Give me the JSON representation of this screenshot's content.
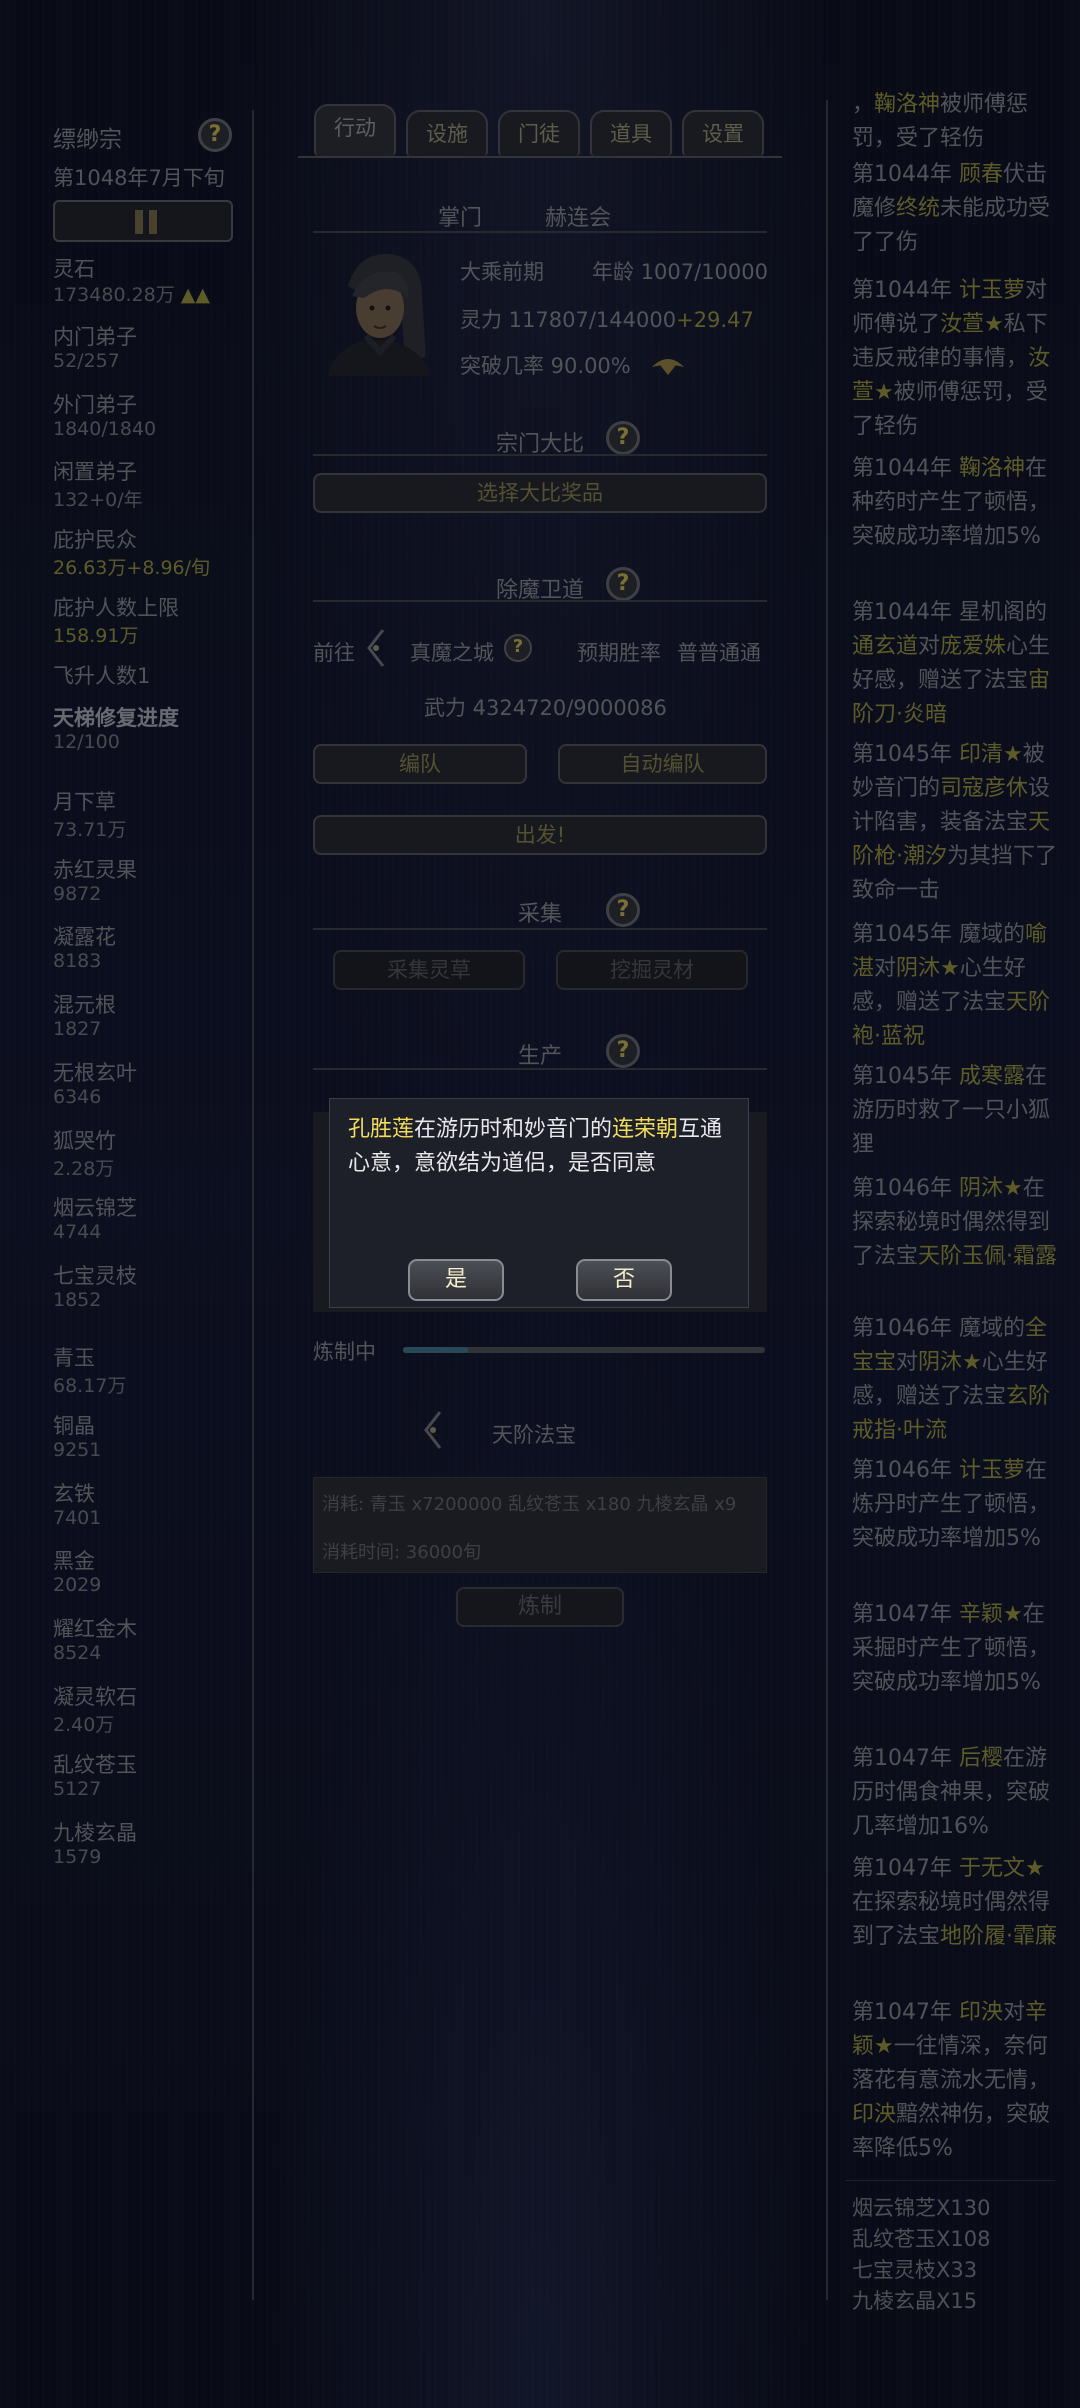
{
  "left": {
    "sect_name": "缥缈宗",
    "date": "第1048年7月下旬",
    "resources": [
      {
        "name": "灵石",
        "value": "173480.28万",
        "extra": "▲▲"
      },
      {
        "name": "内门弟子",
        "value": "52/257"
      },
      {
        "name": "外门弟子",
        "value": "1840/1840"
      },
      {
        "name": "闲置弟子",
        "value": "132+0/年"
      },
      {
        "name": "庇护民众",
        "value": "26.63万",
        "extra": "+8.96/旬"
      },
      {
        "name": "庇护人数上限",
        "value": "158.91万"
      }
    ],
    "ascended": "飞升人数1",
    "ladder_label": "天梯修复进度",
    "ladder_value": "12/100",
    "herbs": [
      {
        "name": "月下草",
        "value": "73.71万"
      },
      {
        "name": "赤红灵果",
        "value": "9872"
      },
      {
        "name": "凝露花",
        "value": "8183"
      },
      {
        "name": "混元根",
        "value": "1827"
      },
      {
        "name": "无根玄叶",
        "value": "6346"
      },
      {
        "name": "狐哭竹",
        "value": "2.28万"
      },
      {
        "name": "烟云锦芝",
        "value": "4744"
      },
      {
        "name": "七宝灵枝",
        "value": "1852"
      }
    ],
    "ores": [
      {
        "name": "青玉",
        "value": "68.17万"
      },
      {
        "name": "铜晶",
        "value": "9251"
      },
      {
        "name": "玄铁",
        "value": "7401"
      },
      {
        "name": "黑金",
        "value": "2029"
      },
      {
        "name": "耀红金木",
        "value": "8524"
      },
      {
        "name": "凝灵软石",
        "value": "2.40万"
      },
      {
        "name": "乱纹苍玉",
        "value": "5127"
      },
      {
        "name": "九棱玄晶",
        "value": "1579"
      }
    ]
  },
  "tabs": [
    "行动",
    "设施",
    "门徒",
    "道具",
    "设置"
  ],
  "leader": {
    "title": "掌门",
    "name": "赫连会",
    "realm": "大乘前期",
    "age": "年龄 1007/10000",
    "spirit": "灵力 117807/144000",
    "spirit_gain": "+29.47",
    "breakthrough": "突破几率 90.00%"
  },
  "competition": {
    "title": "宗门大比",
    "button": "选择大比奖品"
  },
  "demon": {
    "title": "除魔卫道",
    "goto": "前往",
    "target": "真魔之城",
    "expected_label": "预期胜率",
    "expected_value": "普普通通",
    "power": "武力 4324720/9000086",
    "team_button": "编队",
    "auto_team_button": "自动编队",
    "depart_button": "出发!"
  },
  "gather": {
    "title": "采集",
    "herb_button": "采集灵草",
    "mine_button": "挖掘灵材"
  },
  "production": {
    "title": "生产",
    "crafting_label": "炼制中",
    "progress": 0.18,
    "item_name": "天阶法宝",
    "cost": "消耗:  青玉 x7200000 乱纹苍玉 x180 九棱玄晶 x9",
    "time": "消耗时间:  36000旬",
    "craft_button": "炼制"
  },
  "dialog": {
    "name1": "孔胜莲",
    "text1": "在游历时和妙音门的",
    "name2": "连荣朝",
    "text2": "互通心意，意欲结为道侣，是否同意",
    "yes": "是",
    "no": "否"
  },
  "log": [
    {
      "top": "，",
      "tail": "被师傅惩罚，受了轻伤",
      "name": "鞠洛神"
    },
    {
      "year": "第1044年",
      "name": "顾春",
      "rest1": "伏击魔修",
      "name2": "终统",
      "rest2": "未能成功受了了伤"
    },
    {
      "year": "第1044年",
      "name": "计玉萝",
      "rest1": "对师傅说了",
      "name2": "汝萱★",
      "rest2": "私下违反戒律的事情，",
      "name3": "汝萱★",
      "rest3": "被师傅惩罚，受了轻伤"
    },
    {
      "year": "第1044年",
      "name": "鞠洛神",
      "rest1": "在种药时产生了顿悟，突破成功率增加5%"
    },
    {
      "year": "第1044年",
      "pre": "星机阁的",
      "name": "通玄道",
      "rest1": "对",
      "name2": "庞爱姝",
      "rest2": "心生好感，赠送了法宝",
      "name3": "宙阶刀·炎暗"
    },
    {
      "year": "第1045年",
      "name": "印清★",
      "rest1": "被妙音门的",
      "name2": "司寇彦休",
      "rest2": "设计陷害，装备法宝",
      "name3": "天阶枪·潮汐",
      "rest3": "为其挡下了致命一击"
    },
    {
      "year": "第1045年",
      "pre": "魔域的",
      "name": "喻湛",
      "rest1": "对",
      "name2": "阴沐★",
      "rest2": "心生好感，赠送了法宝",
      "name3": "天阶袍·蓝祝"
    },
    {
      "year": "第1045年",
      "name": "成寒露",
      "rest1": "在游历时救了一只小狐狸"
    },
    {
      "year": "第1046年",
      "name": "阴沐★",
      "rest1": "在探索秘境时偶然得到了法宝",
      "name2": "天阶玉佩·霜露"
    },
    {
      "year": "第1046年",
      "pre": "魔域的",
      "name": "全宝宝",
      "rest1": "对",
      "name2": "阴沐★",
      "rest2": "心生好感，赠送了法宝",
      "name3": "玄阶戒指·叶流"
    },
    {
      "year": "第1046年",
      "name": "计玉萝",
      "rest1": "在炼丹时产生了顿悟，突破成功率增加5%"
    },
    {
      "year": "第1047年",
      "name": "辛颖★",
      "rest1": "在采掘时产生了顿悟，突破成功率增加5%"
    },
    {
      "year": "第1047年",
      "name": "后樱",
      "rest1": "在游历时偶食神果，突破几率增加16%"
    },
    {
      "year": "第1047年",
      "name": "于无文★",
      "rest1": "在探索秘境时偶然得到了法宝",
      "name2": "地阶履·霏廉"
    },
    {
      "year": "第1047年",
      "name": "印泱",
      "rest1": "对",
      "name2": "辛颖★",
      "rest2": "一往情深，奈何落花有意流水无情，",
      "name3": "印泱",
      "rest3": "黯然神伤，突破率降低5%"
    }
  ],
  "summary": [
    "烟云锦芝X130",
    "乱纹苍玉X108",
    "七宝灵枝X33",
    "九棱玄晶X15"
  ]
}
